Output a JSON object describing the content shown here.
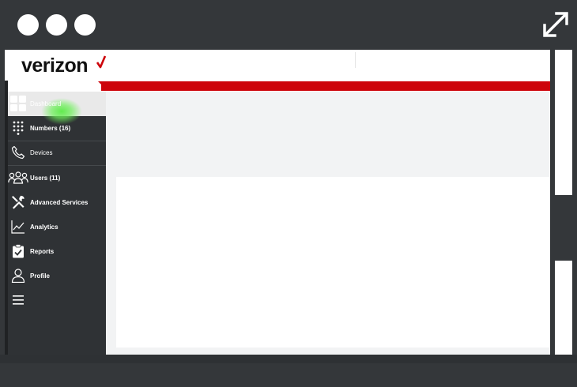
{
  "window": {
    "controls": [
      "dot",
      "dot",
      "dot"
    ],
    "expand_icon": "expand-arrows-icon"
  },
  "header": {
    "logo_text": "verizon",
    "logo_check_color": "#cd040b",
    "accent_color": "#cd040b"
  },
  "sidebar": {
    "items": [
      {
        "label": "Dashboard",
        "icon": "dashboard-grid-icon",
        "active": true
      },
      {
        "label": "Numbers (16)",
        "icon": "dialpad-icon"
      },
      {
        "label": "Devices",
        "icon": "phone-icon"
      },
      {
        "label": "Users (11)",
        "icon": "users-icon"
      },
      {
        "label": "Advanced Services",
        "icon": "tools-icon"
      },
      {
        "label": "Analytics",
        "icon": "chart-icon"
      },
      {
        "label": "Reports",
        "icon": "clipboard-check-icon"
      },
      {
        "label": "Profile",
        "icon": "person-icon"
      },
      {
        "label": "",
        "icon": "menu-icon"
      }
    ]
  }
}
